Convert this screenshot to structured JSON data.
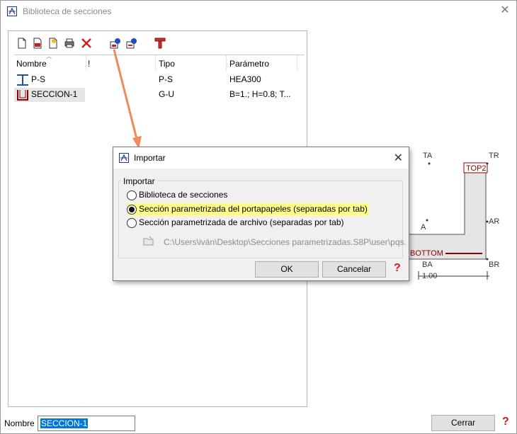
{
  "window": {
    "title": "Biblioteca de secciones",
    "close_glyph": "✕"
  },
  "toolbar": {
    "icons": [
      "new-file-icon",
      "fc-file-icon",
      "open-file-icon",
      "print-icon",
      "delete-icon",
      "import-icon",
      "export-icon",
      "tee-section-icon"
    ]
  },
  "list": {
    "headers": {
      "name": "Nombre",
      "flag": "!",
      "type": "Tipo",
      "param": "Parámetro"
    },
    "rows": [
      {
        "name": "P-S",
        "flag": "",
        "type": "P-S",
        "param": "HEA300",
        "icon": "i-beam-icon"
      },
      {
        "name": "SECCION-1",
        "flag": "",
        "type": "G-U",
        "param": "B=1.; H=0.8; T...",
        "icon": "u-channel-icon"
      }
    ]
  },
  "preview": {
    "labels": {
      "ta": "TA",
      "tr": "TR",
      "top2": "TOP2",
      "a": "A",
      "ar": "AR",
      "bottom": "BOTTOM",
      "ba": "BA",
      "br": "BR",
      "dim": "1.00"
    },
    "accent": "#8b0000"
  },
  "footer": {
    "name_label": "Nombre",
    "name_value": "SECCION-1",
    "close_label": "Cerrar",
    "help": "?"
  },
  "dialog": {
    "title": "Importar",
    "close_glyph": "✕",
    "group_label": "Importar",
    "options": [
      {
        "label": "Biblioteca de secciones",
        "selected": false
      },
      {
        "label": "Sección parametrizada del portapapeles (separadas por tab)",
        "selected": true
      },
      {
        "label": "Sección parametrizada de archivo (separadas por tab)",
        "selected": false
      }
    ],
    "file_path": "C:\\Users\\iván\\Desktop\\Secciones parametrizadas.S8P\\user\\pqs.",
    "ok_label": "OK",
    "cancel_label": "Cancelar",
    "help": "?"
  }
}
